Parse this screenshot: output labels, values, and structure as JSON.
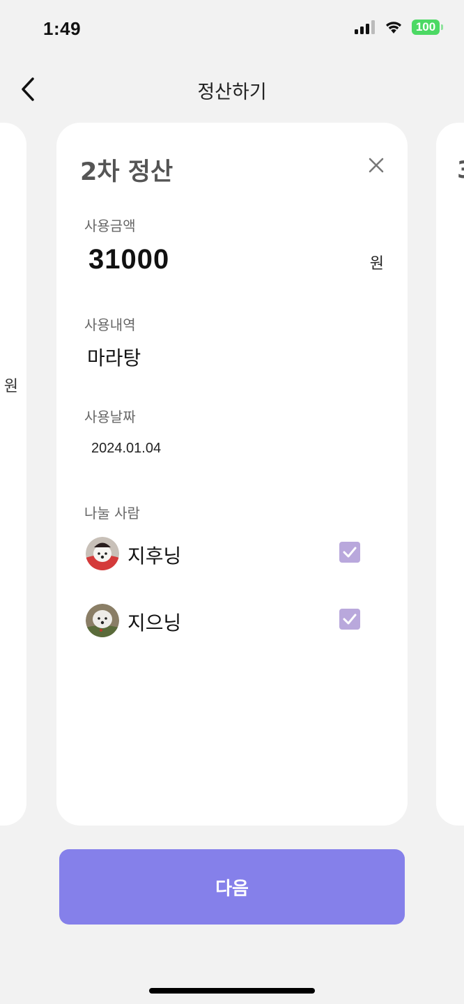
{
  "status_bar": {
    "time": "1:49",
    "battery": "100",
    "icons": [
      "signal-icon",
      "wifi-icon",
      "battery-icon"
    ],
    "battery_color": "#4cd964"
  },
  "header": {
    "title": "정산하기",
    "back_icon": "chevron-left-icon"
  },
  "prev_card": {
    "partial_text": "원"
  },
  "next_card": {
    "partial_text": "3"
  },
  "card": {
    "title": "2차 정산",
    "close_icon": "close-icon",
    "amount_label": "사용금액",
    "amount_value": "31000",
    "currency": "원",
    "memo_label": "사용내역",
    "memo_value": "마라탕",
    "date_label": "사용날짜",
    "date_value": "2024.01.04",
    "share_label": "나눌 사람",
    "participants": [
      {
        "name": "지후닝",
        "checked": true
      },
      {
        "name": "지으닝",
        "checked": true
      }
    ]
  },
  "next_button": {
    "label": "다음",
    "color": "#8580ea"
  },
  "checkbox_color": "#b9a8dc"
}
